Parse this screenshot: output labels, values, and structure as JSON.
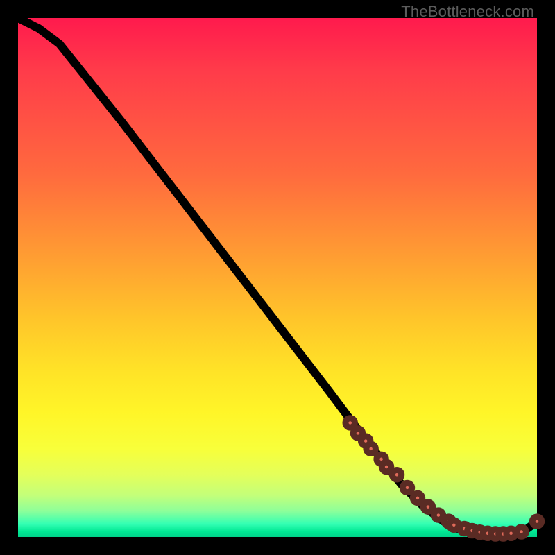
{
  "watermark": "TheBottleneck.com",
  "colors": {
    "frame_bg": "#000000",
    "gradient_top": "#ff1a4d",
    "gradient_mid": "#ffe327",
    "gradient_bottom": "#00d28a",
    "line": "#000000",
    "dot_fill": "#e06a5a",
    "dot_stroke": "#5a2b24"
  },
  "chart_data": {
    "type": "line",
    "title": "",
    "xlabel": "",
    "ylabel": "",
    "xlim": [
      0,
      100
    ],
    "ylim": [
      0,
      100
    ],
    "series": [
      {
        "name": "curve",
        "x": [
          0,
          4,
          8,
          12,
          20,
          30,
          40,
          50,
          60,
          66,
          70,
          74,
          78,
          82,
          85,
          88,
          90,
          92,
          94,
          96,
          98,
          100
        ],
        "y": [
          100,
          98,
          95,
          90,
          80,
          67,
          54,
          41,
          28,
          20,
          15,
          10,
          6,
          3,
          1.5,
          0.8,
          0.5,
          0.4,
          0.5,
          0.9,
          1.5,
          3
        ]
      }
    ],
    "scatter": [
      {
        "name": "dots",
        "x": [
          64,
          65.5,
          67,
          68,
          70,
          71,
          73,
          75,
          77,
          79,
          81,
          83,
          84,
          86,
          87.5,
          89,
          90.5,
          92,
          93.5,
          95,
          97,
          100
        ],
        "y": [
          22,
          20,
          18.5,
          17,
          15,
          13.5,
          12,
          9.5,
          7.5,
          5.8,
          4.2,
          3,
          2.3,
          1.6,
          1.2,
          0.9,
          0.7,
          0.6,
          0.6,
          0.7,
          1.0,
          3
        ]
      }
    ]
  }
}
